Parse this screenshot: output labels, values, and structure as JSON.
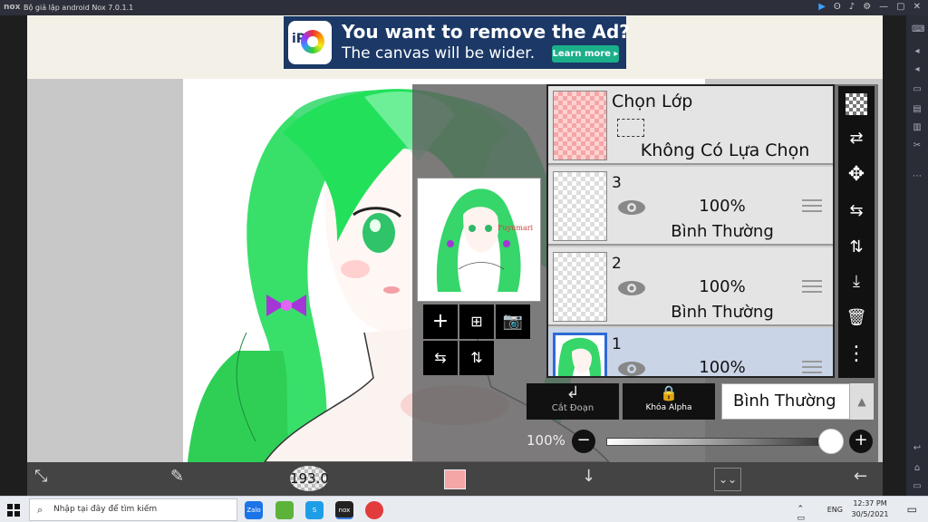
{
  "emulator": {
    "logo": "nox",
    "title": "Bộ giả lập android Nox 7.0.1.1",
    "controls": [
      "▶",
      "ʘ",
      "♪",
      "⚙",
      "—",
      "▢",
      "✕"
    ]
  },
  "ad": {
    "icon_text": "iP",
    "headline": "You want to remove the Ad?",
    "subline": "The canvas will be wider.",
    "button": "Learn more ▸"
  },
  "preview": {
    "signature": "Fuyumari"
  },
  "layers": {
    "selection": {
      "title": "Chọn Lớp",
      "status": "Không Có Lựa Chọn"
    },
    "items": [
      {
        "number": "3",
        "opacity": "100%",
        "blend": "Bình Thường"
      },
      {
        "number": "2",
        "opacity": "100%",
        "blend": "Bình Thường"
      },
      {
        "number": "1",
        "opacity": "100%",
        "blend": ""
      }
    ]
  },
  "layer_controls": {
    "cut_label": "Cắt Đoạn",
    "alpha_label": "Khóa Alpha",
    "blend_mode": "Bình Thường",
    "opacity_label": "100%",
    "opacity_value": 1.0
  },
  "toolbar": {
    "brush_size": "193.0",
    "color": "#f4a6a6"
  },
  "taskbar": {
    "search_placeholder": "Nhập tại đây để tìm kiếm",
    "apps": [
      "Zalo",
      "",
      "S",
      "nox",
      ""
    ],
    "language": "ENG",
    "time": "12:37 PM",
    "date": "30/5/2021"
  }
}
